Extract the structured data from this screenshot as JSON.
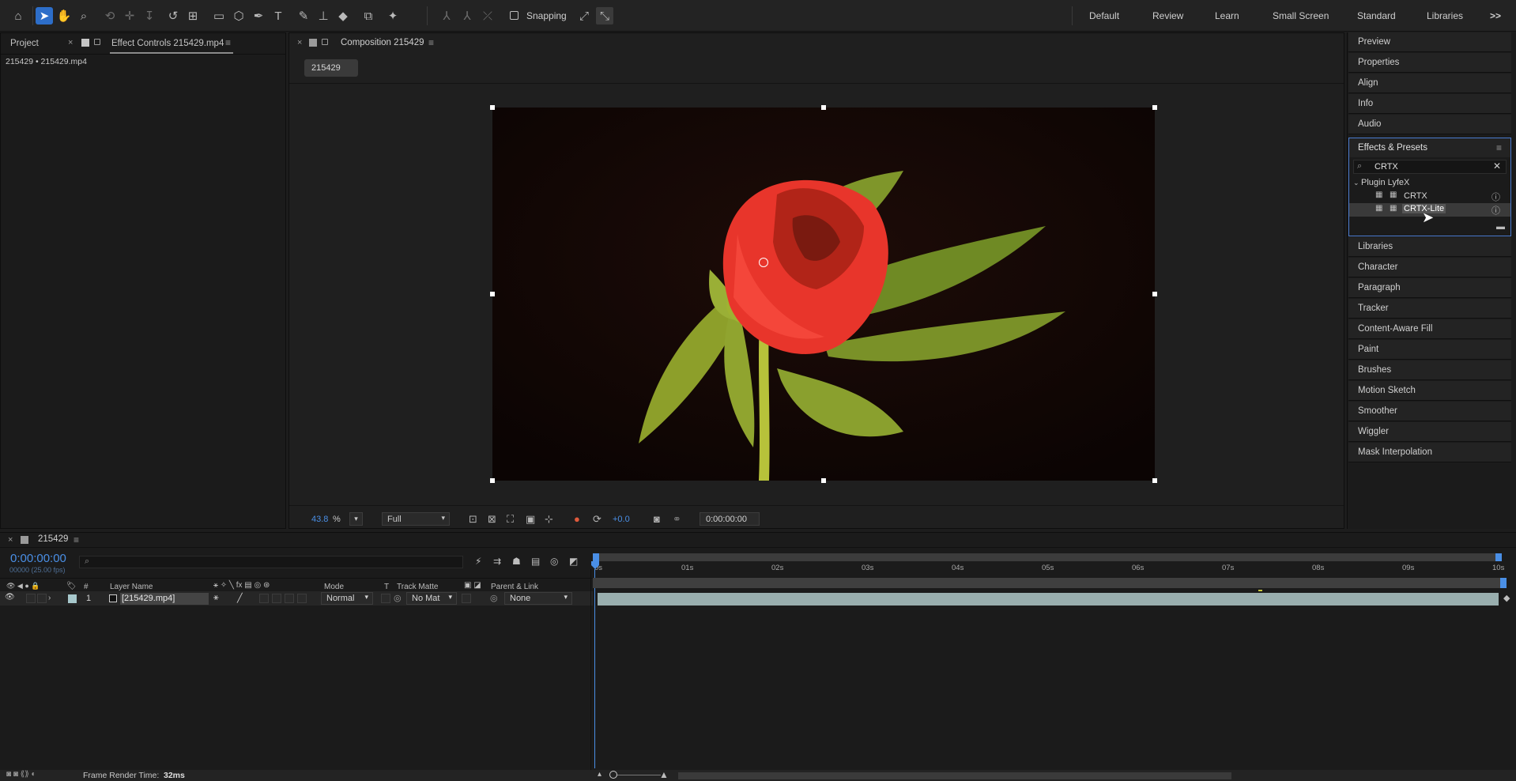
{
  "toolbar": {
    "snapping_label": "Snapping",
    "workspaces": [
      "Default",
      "Review",
      "Learn",
      "Small Screen",
      "Standard",
      "Libraries"
    ],
    "overflow_label": ">>"
  },
  "project_panel": {
    "tab_project": "Project",
    "tab_effect_controls": "Effect Controls 215429.mp4",
    "layer_path": "215429 • 215429.mp4"
  },
  "composition_panel": {
    "tab_label": "Composition 215429",
    "breadcrumb": "215429",
    "zoom": "43.8",
    "zoom_unit": "%",
    "resolution": "Full",
    "exposure": "+0.0",
    "timecode": "0:00:00:00"
  },
  "right_dock": {
    "top_items": [
      "Preview",
      "Properties",
      "Align",
      "Info",
      "Audio"
    ],
    "effects": {
      "title": "Effects & Presets",
      "search_value": "CRTX",
      "folder": "Plugin LyfeX",
      "items": [
        "CRTX",
        "CRTX-Lite"
      ]
    },
    "bottom_items": [
      "Libraries",
      "Character",
      "Paragraph",
      "Tracker",
      "Content-Aware Fill",
      "Paint",
      "Brushes",
      "Motion Sketch",
      "Smoother",
      "Wiggler",
      "Mask Interpolation"
    ]
  },
  "timeline": {
    "comp_name": "215429",
    "timecode": "0:00:00:00",
    "sub_timecode": "00000 (25.00 fps)",
    "columns": {
      "number": "#",
      "layer_name": "Layer Name",
      "mode": "Mode",
      "t": "T",
      "track_matte": "Track Matte",
      "parent": "Parent & Link"
    },
    "ruler": [
      "0s",
      "01s",
      "02s",
      "03s",
      "04s",
      "05s",
      "06s",
      "07s",
      "08s",
      "09s",
      "10s"
    ],
    "layer": {
      "index": "1",
      "name": "[215429.mp4]",
      "mode": "Normal",
      "track_matte": "No Mat",
      "parent": "None"
    }
  },
  "status": {
    "render_label": "Frame Render Time:",
    "render_value": "32ms"
  },
  "colors": {
    "accent": "#2d6ec9",
    "timecode": "#4a8fe6",
    "panel_bg": "#1b1b1b",
    "flower": "#e8352b",
    "leaf": "#8aa02a"
  }
}
